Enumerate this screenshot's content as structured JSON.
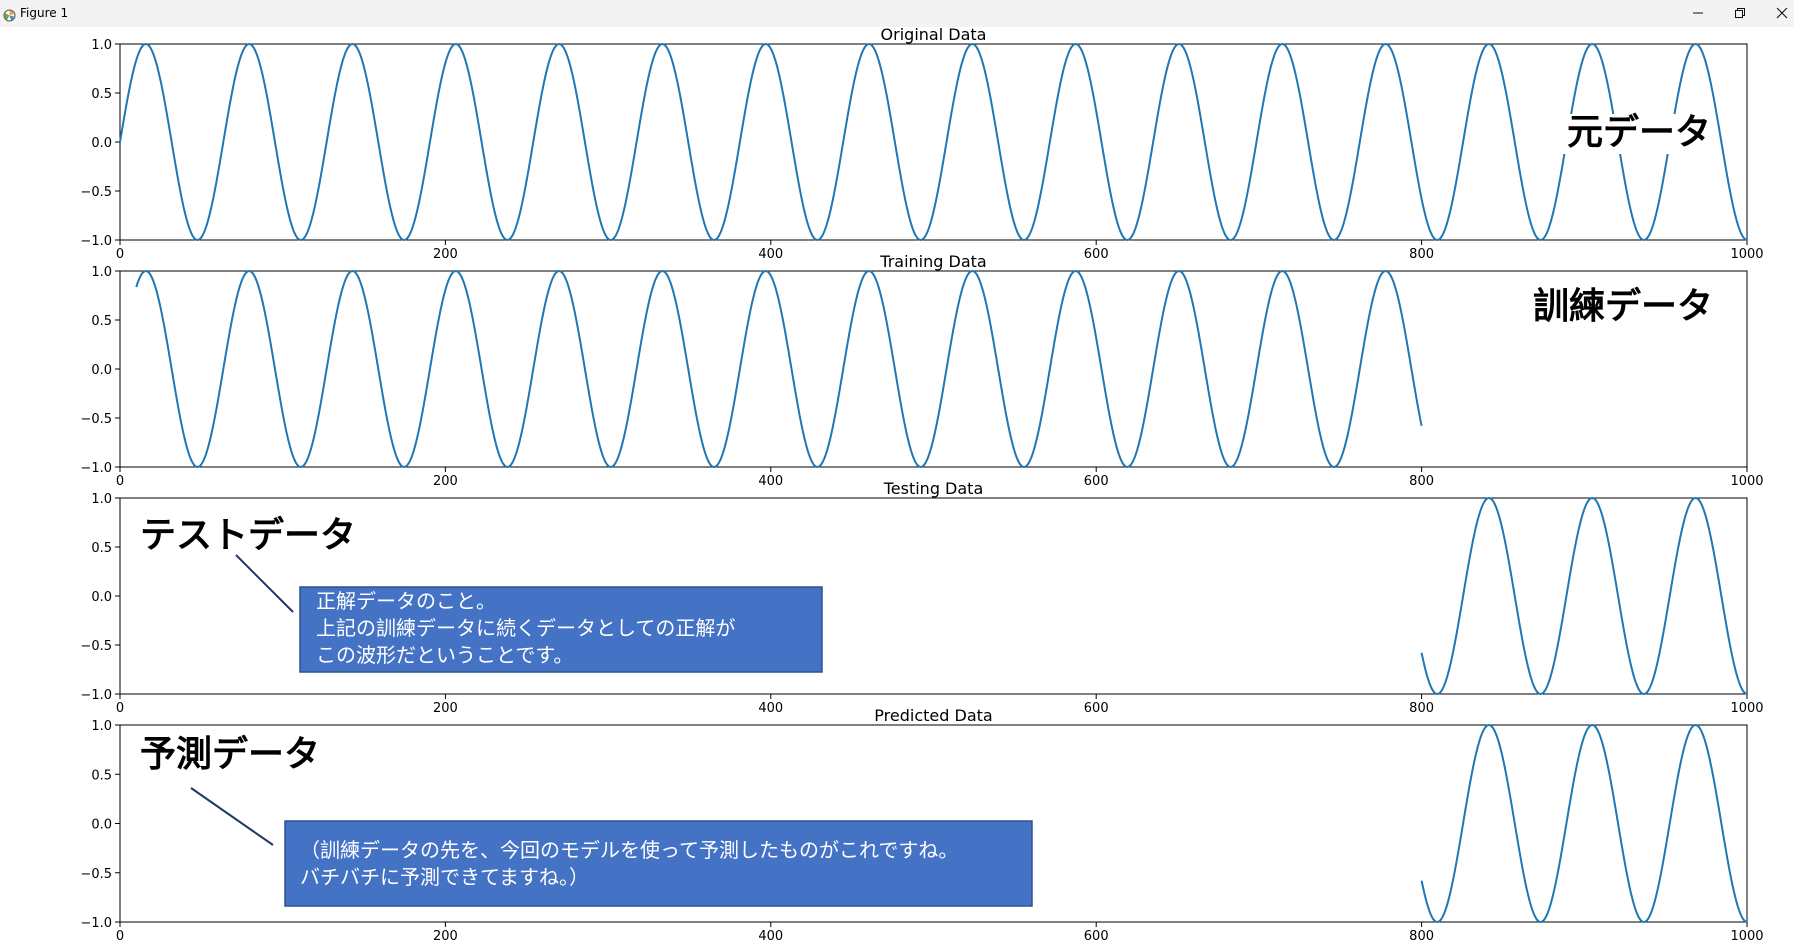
{
  "window": {
    "title": "Figure 1",
    "icons": {
      "app": "matplotlib-icon",
      "minimize": "minimize-icon",
      "restore": "restore-icon",
      "close": "close-icon"
    }
  },
  "colors": {
    "line": "#1f77b4",
    "callout_fill": "#4472c4",
    "callout_border": "#2f528f",
    "callout_text": "#ffffff",
    "connector": "#1f3864"
  },
  "chart_data": [
    {
      "type": "line",
      "title": "Original Data",
      "xlim": [
        0,
        1000
      ],
      "ylim": [
        -1.0,
        1.0
      ],
      "xticks": [
        0,
        200,
        400,
        600,
        800,
        1000
      ],
      "yticks": [
        1.0,
        0.5,
        0.0,
        -0.5,
        -1.0
      ],
      "series": [
        {
          "function": "sin",
          "period": 63.5,
          "x_start": 0,
          "x_end": 1000
        }
      ],
      "annotation": {
        "text": "元データ",
        "position": "top-right"
      }
    },
    {
      "type": "line",
      "title": "Training Data",
      "xlim": [
        0,
        1000
      ],
      "ylim": [
        -1.0,
        1.0
      ],
      "xticks": [
        0,
        200,
        400,
        600,
        800,
        1000
      ],
      "yticks": [
        1.0,
        0.5,
        0.0,
        -0.5,
        -1.0
      ],
      "series": [
        {
          "function": "sin",
          "period": 63.5,
          "x_start": 10,
          "x_end": 800
        }
      ],
      "annotation": {
        "text": "訓練データ",
        "position": "top-right"
      }
    },
    {
      "type": "line",
      "title": "Testing Data",
      "xlim": [
        0,
        1000
      ],
      "ylim": [
        -1.0,
        1.0
      ],
      "xticks": [
        0,
        200,
        400,
        600,
        800,
        1000
      ],
      "yticks": [
        1.0,
        0.5,
        0.0,
        -0.5,
        -1.0
      ],
      "series": [
        {
          "function": "sin",
          "period": 63.5,
          "x_start": 800,
          "x_end": 1000
        }
      ],
      "annotation": {
        "text": "テストデータ",
        "position": "top-left"
      },
      "callout": {
        "lines": [
          "正解データのこと。",
          "上記の訓練データに続くデータとしての正解が",
          "この波形だということです。"
        ]
      }
    },
    {
      "type": "line",
      "title": "Predicted Data",
      "xlim": [
        0,
        1000
      ],
      "ylim": [
        -1.0,
        1.0
      ],
      "xticks": [
        0,
        200,
        400,
        600,
        800,
        1000
      ],
      "yticks": [
        1.0,
        0.5,
        0.0,
        -0.5,
        -1.0
      ],
      "series": [
        {
          "function": "sin",
          "period": 63.5,
          "x_start": 800,
          "x_end": 1000
        }
      ],
      "annotation": {
        "text": "予測データ",
        "position": "top-left"
      },
      "callout": {
        "lines": [
          "（訓練データの先を、今回のモデルを使って予測したものがこれですね。",
          "バチバチに予測できてますね。）"
        ]
      }
    }
  ]
}
